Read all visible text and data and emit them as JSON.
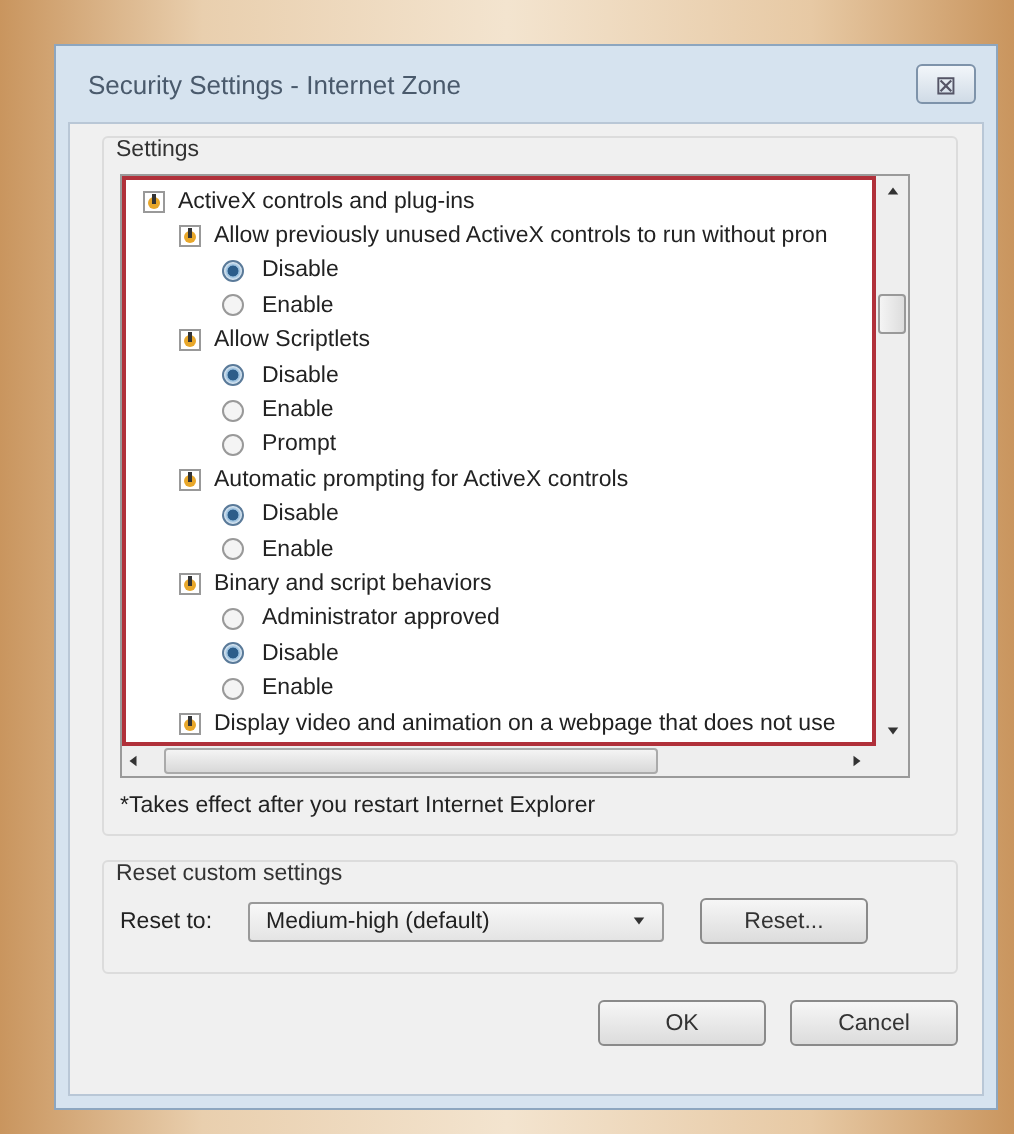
{
  "window": {
    "title": "Security Settings - Internet Zone",
    "close_glyph": "⊠"
  },
  "settings": {
    "label": "Settings",
    "tree": [
      {
        "label": "ActiveX controls and plug-ins",
        "children": [
          {
            "label": "Allow previously unused ActiveX controls to run without pron",
            "options": [
              {
                "label": "Disable",
                "selected": true
              },
              {
                "label": "Enable",
                "selected": false
              }
            ]
          },
          {
            "label": "Allow Scriptlets",
            "options": [
              {
                "label": "Disable",
                "selected": true
              },
              {
                "label": "Enable",
                "selected": false
              },
              {
                "label": "Prompt",
                "selected": false
              }
            ]
          },
          {
            "label": "Automatic prompting for ActiveX controls",
            "options": [
              {
                "label": "Disable",
                "selected": true
              },
              {
                "label": "Enable",
                "selected": false
              }
            ]
          },
          {
            "label": "Binary and script behaviors",
            "options": [
              {
                "label": "Administrator approved",
                "selected": false
              },
              {
                "label": "Disable",
                "selected": true
              },
              {
                "label": "Enable",
                "selected": false
              }
            ]
          },
          {
            "label": "Display video and animation on a webpage that does not use"
          }
        ]
      }
    ],
    "footnote": "*Takes effect after you restart Internet Explorer"
  },
  "reset": {
    "label": "Reset custom settings",
    "field_label": "Reset to:",
    "value": "Medium-high (default)",
    "button": "Reset..."
  },
  "buttons": [
    "OK",
    "Cancel"
  ]
}
